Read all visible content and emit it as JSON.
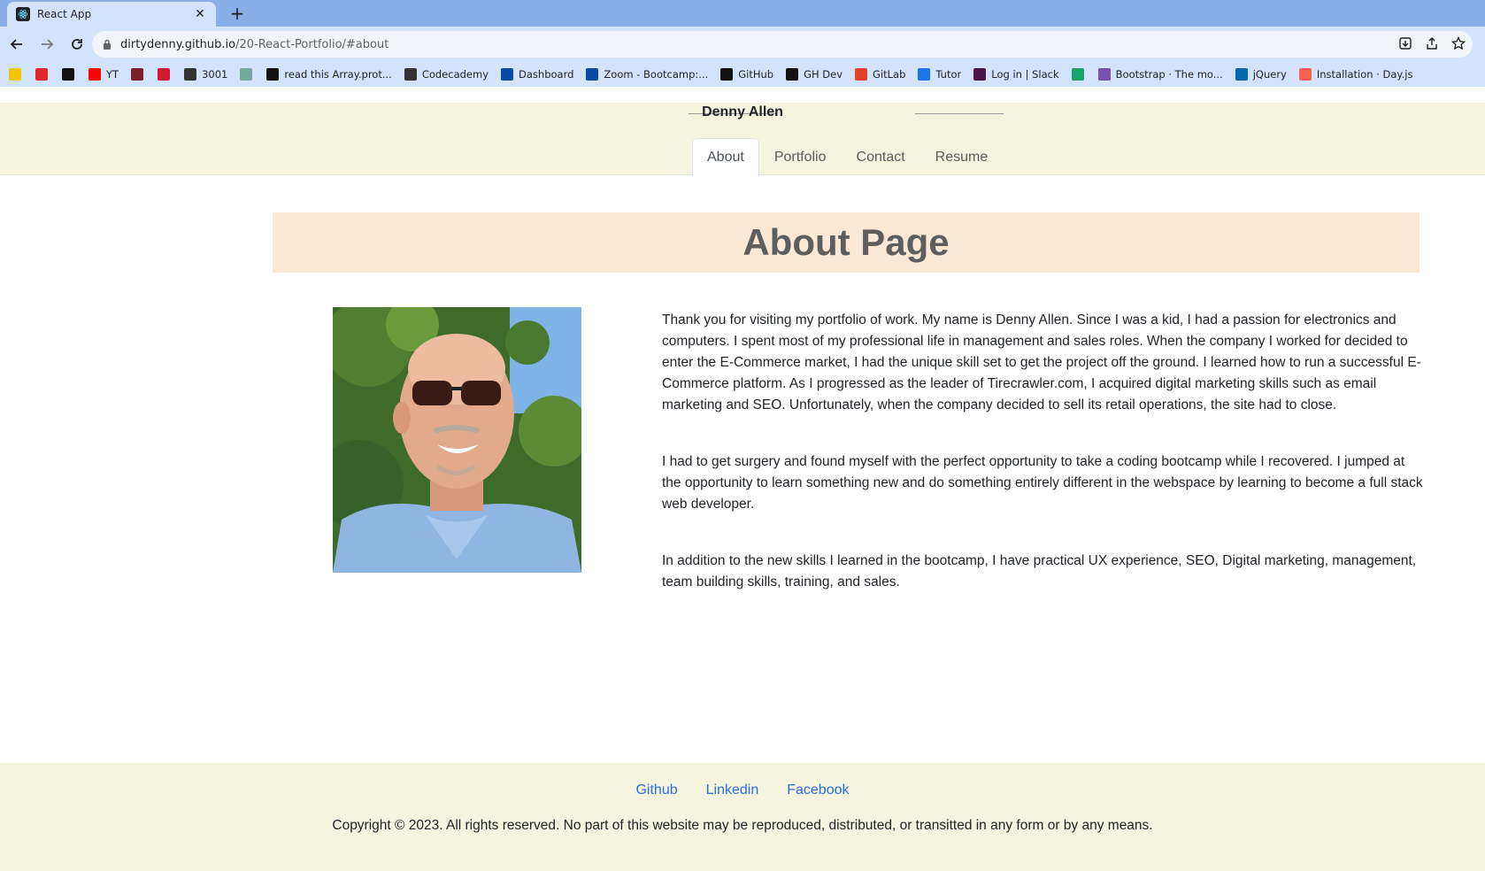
{
  "browser": {
    "tab_title": "React App",
    "url_host": "dirtydenny.github.io",
    "url_path": "/20-React-Portfolio/#about",
    "bookmarks": [
      {
        "label": "",
        "icon": "folder-icon",
        "color": "#f5c400"
      },
      {
        "label": "",
        "icon": "c-icon",
        "color": "#e3262e"
      },
      {
        "label": "",
        "icon": "n-icon",
        "color": "#111111"
      },
      {
        "label": "YT",
        "icon": "youtube-icon",
        "color": "#ff0000"
      },
      {
        "label": "",
        "icon": "tower-icon",
        "color": "#7a1f2b"
      },
      {
        "label": "",
        "icon": "r-icon",
        "color": "#d1192f"
      },
      {
        "label": "3001",
        "icon": "globe-icon",
        "color": "#333333"
      },
      {
        "label": "",
        "icon": "openai-icon",
        "color": "#74aa9c"
      },
      {
        "label": "read this Array.prot...",
        "icon": "mdn-icon",
        "color": "#111111"
      },
      {
        "label": "Codecademy",
        "icon": "codecademy-icon",
        "color": "#333333"
      },
      {
        "label": "Dashboard",
        "icon": "uci-icon",
        "color": "#0b4aa2"
      },
      {
        "label": "Zoom - Bootcamp:...",
        "icon": "uci-icon",
        "color": "#0b4aa2"
      },
      {
        "label": "GitHub",
        "icon": "github-icon",
        "color": "#111111"
      },
      {
        "label": "GH Dev",
        "icon": "github-icon",
        "color": "#111111"
      },
      {
        "label": "GitLab",
        "icon": "gitlab-icon",
        "color": "#e24329"
      },
      {
        "label": "Tutor",
        "icon": "tutor-icon",
        "color": "#1a73e8"
      },
      {
        "label": "Log in | Slack",
        "icon": "slack-icon",
        "color": "#4a154b"
      },
      {
        "label": "",
        "icon": "w-icon",
        "color": "#1aa36a"
      },
      {
        "label": "Bootstrap · The mo...",
        "icon": "bootstrap-icon",
        "color": "#7952b3"
      },
      {
        "label": "jQuery",
        "icon": "jquery-icon",
        "color": "#0769ad"
      },
      {
        "label": "Installation · Day.js",
        "icon": "dayjs-icon",
        "color": "#fb6052"
      }
    ]
  },
  "header": {
    "brand": "Denny Allen",
    "tabs": [
      "About",
      "Portfolio",
      "Contact",
      "Resume"
    ],
    "active_tab": "About"
  },
  "main": {
    "heading": "About Page",
    "photo_alt": "Denny Allen",
    "paragraphs": [
      "Thank you for visiting my portfolio of work. My name is Denny Allen. Since I was a kid, I had a passion for electronics and computers. I spent most of my professional life in management and sales roles. When the company I worked for decided to enter the E-Commerce market, I had the unique skill set to get the project off the ground. I learned how to run a successful E-Commerce platform. As I progressed as the leader of Tirecrawler.com, I acquired digital marketing skills such as email marketing and SEO. Unfortunately, when the company decided to sell its retail operations, the site had to close.",
      "I had to get surgery and found myself with the perfect opportunity to take a coding bootcamp while I recovered. I jumped at the opportunity to learn something new and do something entirely different in the webspace by learning to become a full stack web developer.",
      "In addition to the new skills I learned in the bootcamp, I have practical UX experience, SEO, Digital marketing, management, team building skills, training, and sales."
    ]
  },
  "footer": {
    "links": [
      "Github",
      "Linkedin",
      "Facebook"
    ],
    "copyright": "Copyright © 2023. All rights reserved. No part of this website may be reproduced, distributed, or transitted in any form or by any means."
  },
  "colors": {
    "header_bg": "#f5f4df",
    "banner_bg": "#fbe9d6",
    "link": "#2a6ce0"
  }
}
